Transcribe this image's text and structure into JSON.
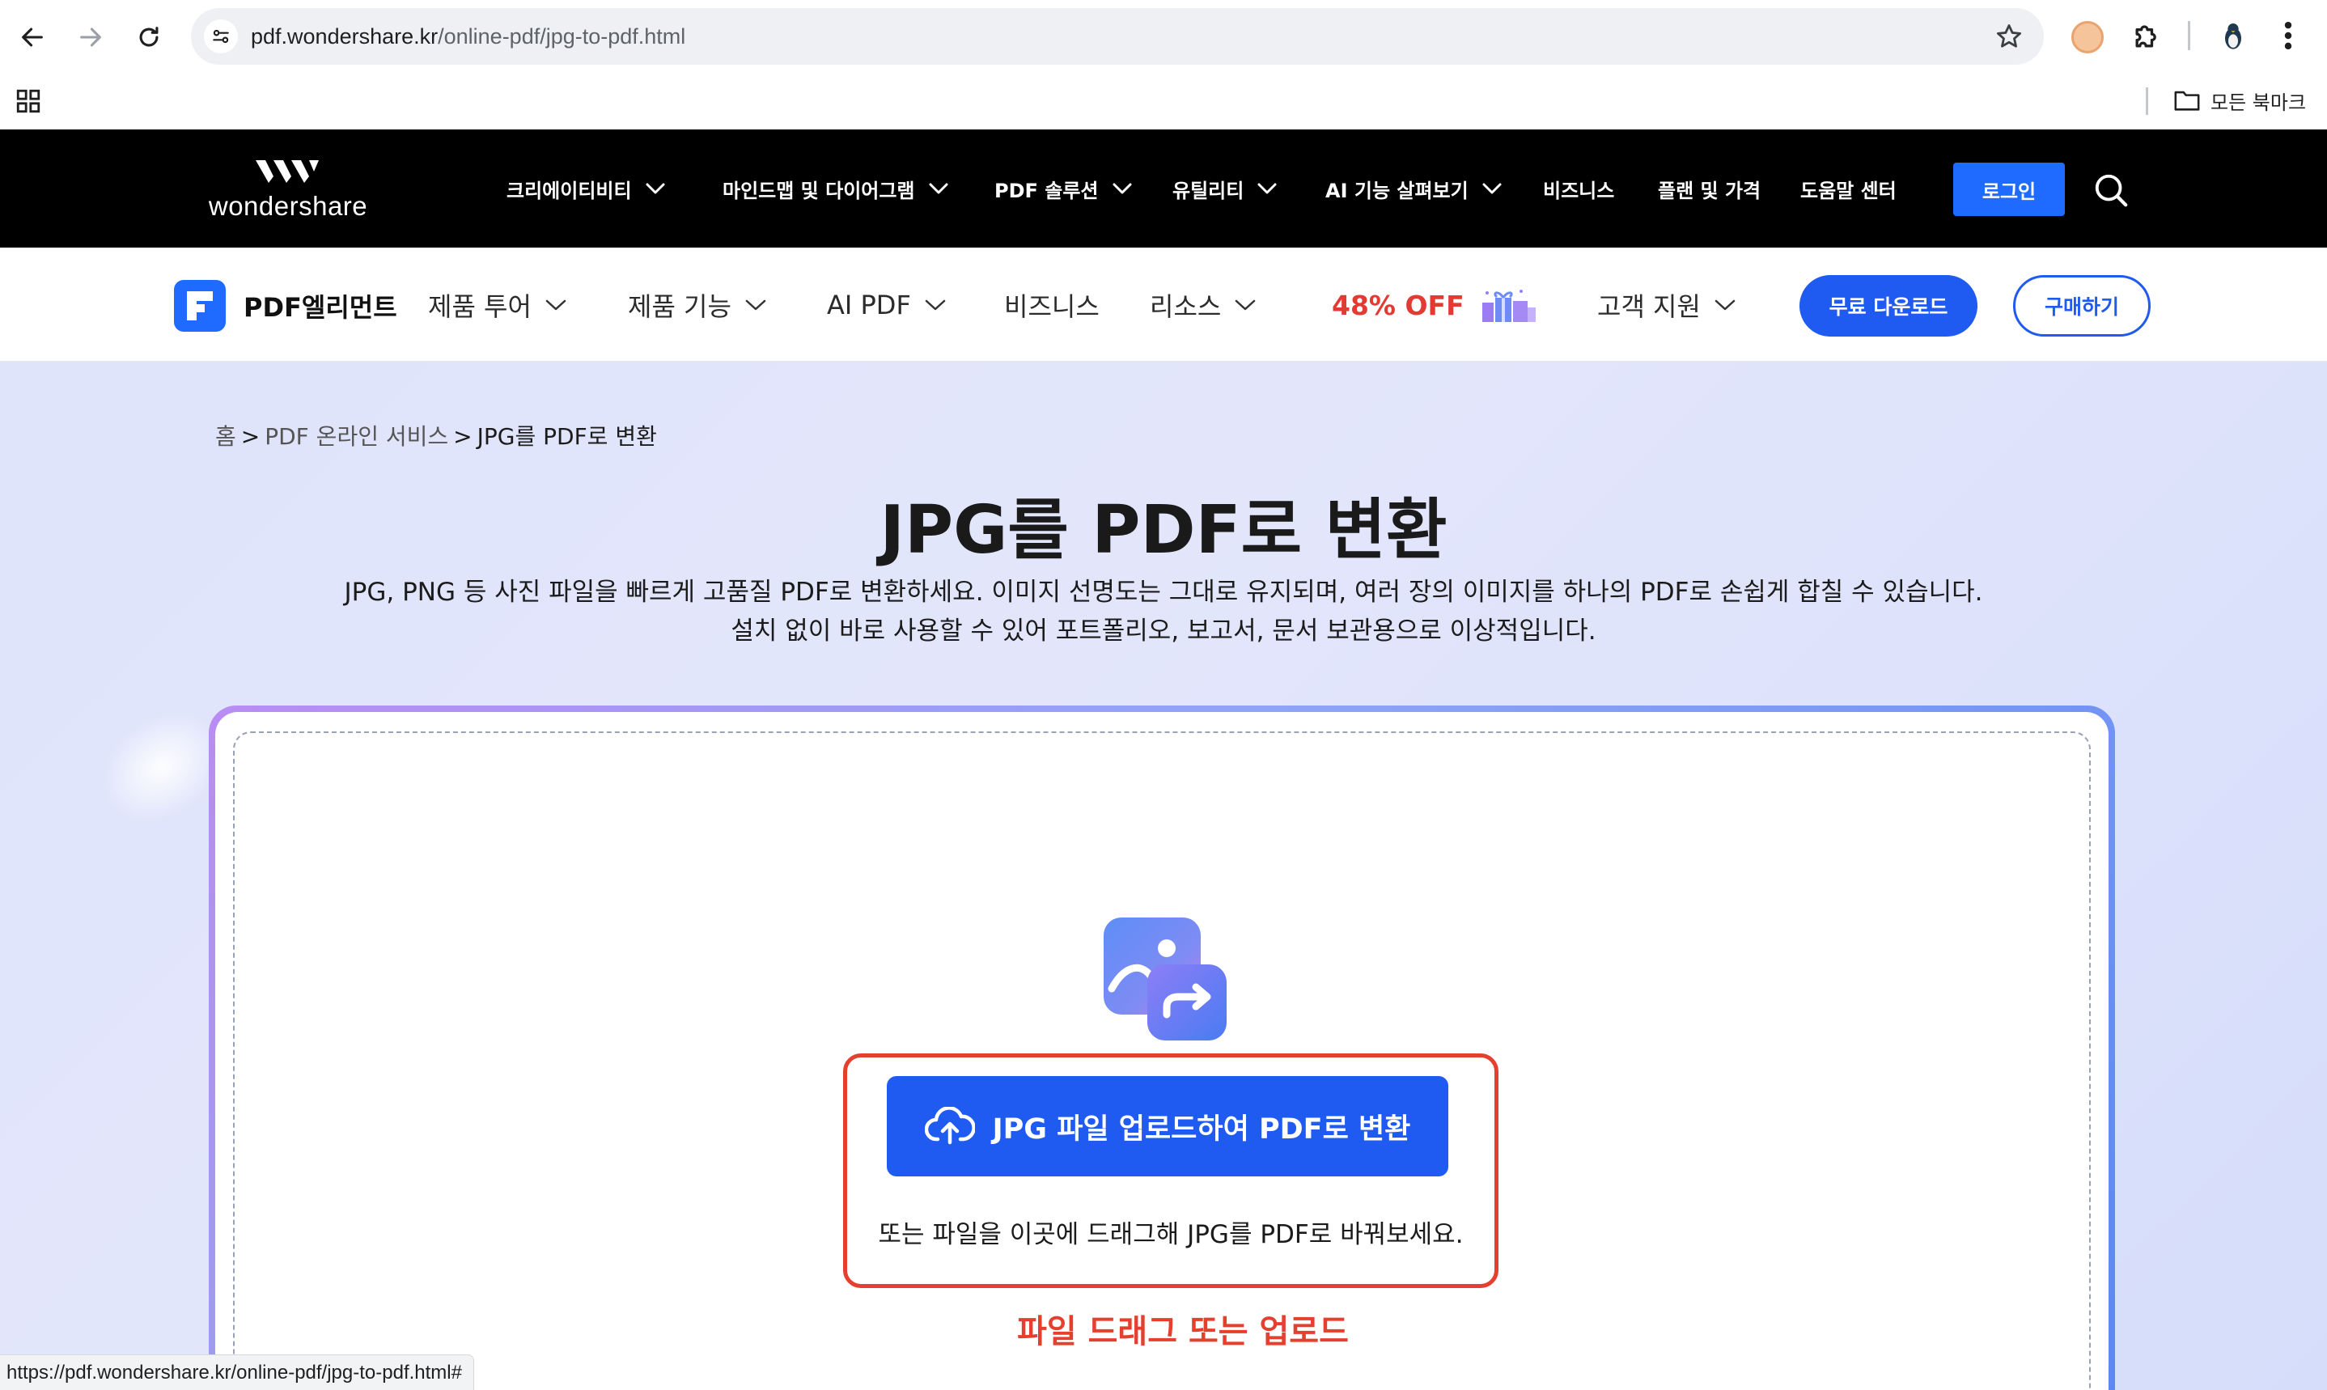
{
  "browser": {
    "url_domain": "pdf.wondershare.kr",
    "url_path": "/online-pdf/jpg-to-pdf.html",
    "all_bookmarks_label": "모든 북마크",
    "status_url": "https://pdf.wondershare.kr/online-pdf/jpg-to-pdf.html#"
  },
  "topnav": {
    "logo_text": "wondershare",
    "items": [
      {
        "label": "크리에이티비티",
        "has_dropdown": true
      },
      {
        "label": "마인드맵 및 다이어그램",
        "has_dropdown": true
      },
      {
        "label": "PDF 솔루션",
        "has_dropdown": true
      },
      {
        "label": "유틸리티",
        "has_dropdown": true
      },
      {
        "label": "AI 기능 살펴보기",
        "has_dropdown": true
      },
      {
        "label": "비즈니스",
        "has_dropdown": false
      },
      {
        "label": "플랜 및 가격",
        "has_dropdown": false
      },
      {
        "label": "도움말 센터",
        "has_dropdown": false
      }
    ],
    "login_label": "로그인"
  },
  "subnav": {
    "product_name": "PDF엘리먼트",
    "items": [
      {
        "label": "제품 투어",
        "has_dropdown": true
      },
      {
        "label": "제품 기능",
        "has_dropdown": true
      },
      {
        "label": "AI PDF",
        "has_dropdown": true
      },
      {
        "label": "비즈니스",
        "has_dropdown": false
      },
      {
        "label": "리소스",
        "has_dropdown": true
      }
    ],
    "promo_label": "48% OFF",
    "support_label": "고객 지원",
    "download_label": "무료 다운로드",
    "buy_label": "구매하기"
  },
  "breadcrumb": {
    "home": "홈",
    "separator": ">",
    "section": "PDF 온라인 서비스",
    "current": "JPG를 PDF로 변환"
  },
  "hero": {
    "title": "JPG를 PDF로 변환",
    "description_line1": "JPG, PNG 등 사진 파일을 빠르게 고품질 PDF로 변환하세요. 이미지 선명도는 그대로 유지되며, 여러 장의 이미지를 하나의 PDF로 손쉽게 합칠 수 있습니다.",
    "description_line2": "설치 없이 바로 사용할 수 있어 포트폴리오, 보고서, 문서 보관용으로 이상적입니다."
  },
  "upload": {
    "button_label": "JPG 파일 업로드하여 PDF로 변환",
    "drag_hint": "또는 파일을 이곳에 드래그해 JPG를 PDF로 바꿔보세요.",
    "annotation": "파일 드래그 또는 업로드"
  },
  "colors": {
    "brand_blue": "#1f5bf0",
    "promo_red": "#e23b33",
    "annotation_red": "#e5402f",
    "topnav_bg": "#000000"
  },
  "icons": [
    "back-arrow-icon",
    "forward-arrow-icon",
    "reload-icon",
    "site-settings-icon",
    "bookmark-star-icon",
    "extension-avatar-icon",
    "extensions-puzzle-icon",
    "profile-avatar-icon",
    "more-menu-icon",
    "apps-grid-icon",
    "folder-icon",
    "chevron-down-icon",
    "search-icon",
    "gift-icon",
    "image-convert-icon",
    "cloud-upload-icon"
  ]
}
